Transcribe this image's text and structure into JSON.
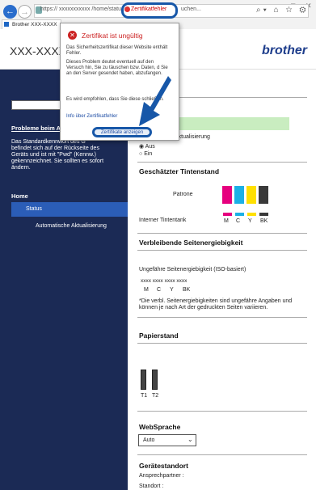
{
  "browser": {
    "url": "https:// xxxxxxxxxxx /home/status.htt",
    "cert_label": "Zertifikatfehler",
    "search_text": "uchen...",
    "tab_title": "Brother XXX-XXXX"
  },
  "header": {
    "model": "XXX-XXXX",
    "logo": "brother"
  },
  "sidebar": {
    "problem_title": "Probleme beim A",
    "problem_text": "Das Standardkennwort des G befindet sich auf der Rückseite des Geräts und ist mit \"Pwd\" (Kennw.) gekennzeichnet. Sie sollten es sofort ändern.",
    "home": "Home",
    "status": "Status",
    "auto_update": "Automatische Aktualisierung"
  },
  "popup": {
    "title": "Zertifikat ist ungültig",
    "p1": "Das Sicherheitszertifikat dieser Website enthält Fehler.",
    "p2": "Dieses Problem deutet eventuell auf den Versuch hin, Sie zu täuschen bzw. Daten, d Sie an den Server gesendet haben, abzufangen.",
    "p3": "Es wird empfohlen, dass Sie diese schließen.",
    "info": "Info über Zertifikatfehler",
    "button": "Zertifikate anzeigen"
  },
  "main": {
    "auto_update_title": "Automatische Aktualisierung",
    "opt_off": "Aus",
    "opt_on": "Ein",
    "ink_title": "Geschätzter Tintenstand",
    "cartridge": "Patrone",
    "internal_tank": "Interner Tintentank",
    "ink_colors": [
      "#e6007e",
      "#1bb0e6",
      "#ffe000",
      "#3a3a3a"
    ],
    "ink_letters": [
      "M",
      "C",
      "Y",
      "BK"
    ],
    "energy_title": "Verbleibende Seitenergiebigkeit",
    "energy_sub": "Ungefähre Seitenergiebigkeit (ISO-basiert)",
    "energy_values": "xxxx  xxxx  xxxx  xxxx",
    "energy_letters": [
      "M",
      "C",
      "Y",
      "BK"
    ],
    "energy_note": "*Die verbl. Seitenergiebigkeiten sind ungefähre Angaben und können je nach Art der gedruckten Seiten variieren.",
    "paper_title": "Papierstand",
    "trays": [
      "T1",
      "T2"
    ],
    "lang_title": "WebSprache",
    "lang_value": "Auto",
    "location_title": "Gerätestandort",
    "contact": "Ansprechpartner :",
    "location": "Standort :"
  }
}
